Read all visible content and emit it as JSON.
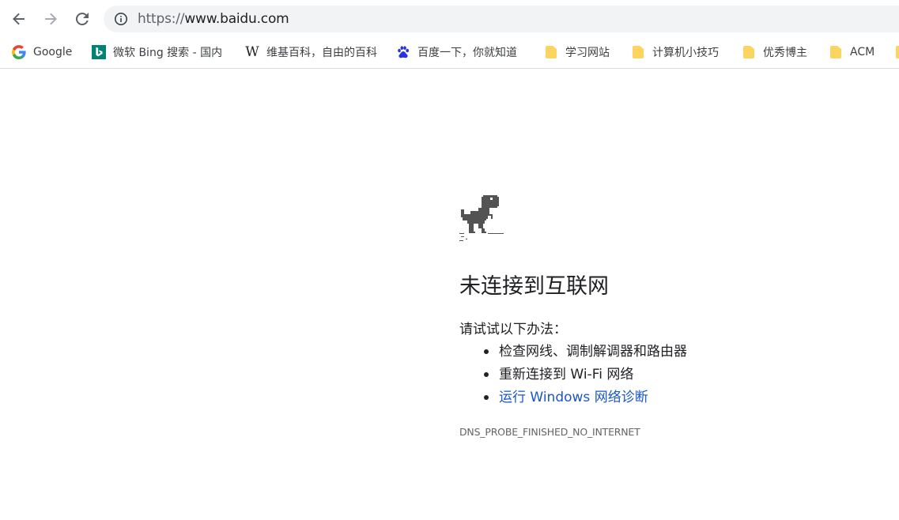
{
  "toolbar": {
    "back_icon": "arrow-left-icon",
    "forward_icon": "arrow-right-icon",
    "reload_icon": "reload-icon",
    "url_scheme": "https://",
    "url_host": "www.baidu.com"
  },
  "bookmarks": [
    {
      "label": "Google",
      "icon": "google-icon"
    },
    {
      "label": "微软 Bing 搜索 - 国内",
      "icon": "bing-icon"
    },
    {
      "label": "维基百科，自由的百科",
      "icon": "wikipedia-icon"
    },
    {
      "label": "百度一下，你就知道",
      "icon": "baidu-icon"
    },
    {
      "label": "学习网站",
      "icon": "folder-icon"
    },
    {
      "label": "计算机小技巧",
      "icon": "folder-icon"
    },
    {
      "label": "优秀博主",
      "icon": "folder-icon"
    },
    {
      "label": "ACM",
      "icon": "folder-icon"
    }
  ],
  "error_page": {
    "heading": "未连接到互联网",
    "suggestions_title": "请试试以下办法：",
    "suggestions": [
      "检查网线、调制解调器和路由器",
      "重新连接到 Wi-Fi 网络",
      "运行 Windows 网络诊断"
    ],
    "error_code": "DNS_PROBE_FINISHED_NO_INTERNET",
    "link_color": "#1a56c7"
  }
}
